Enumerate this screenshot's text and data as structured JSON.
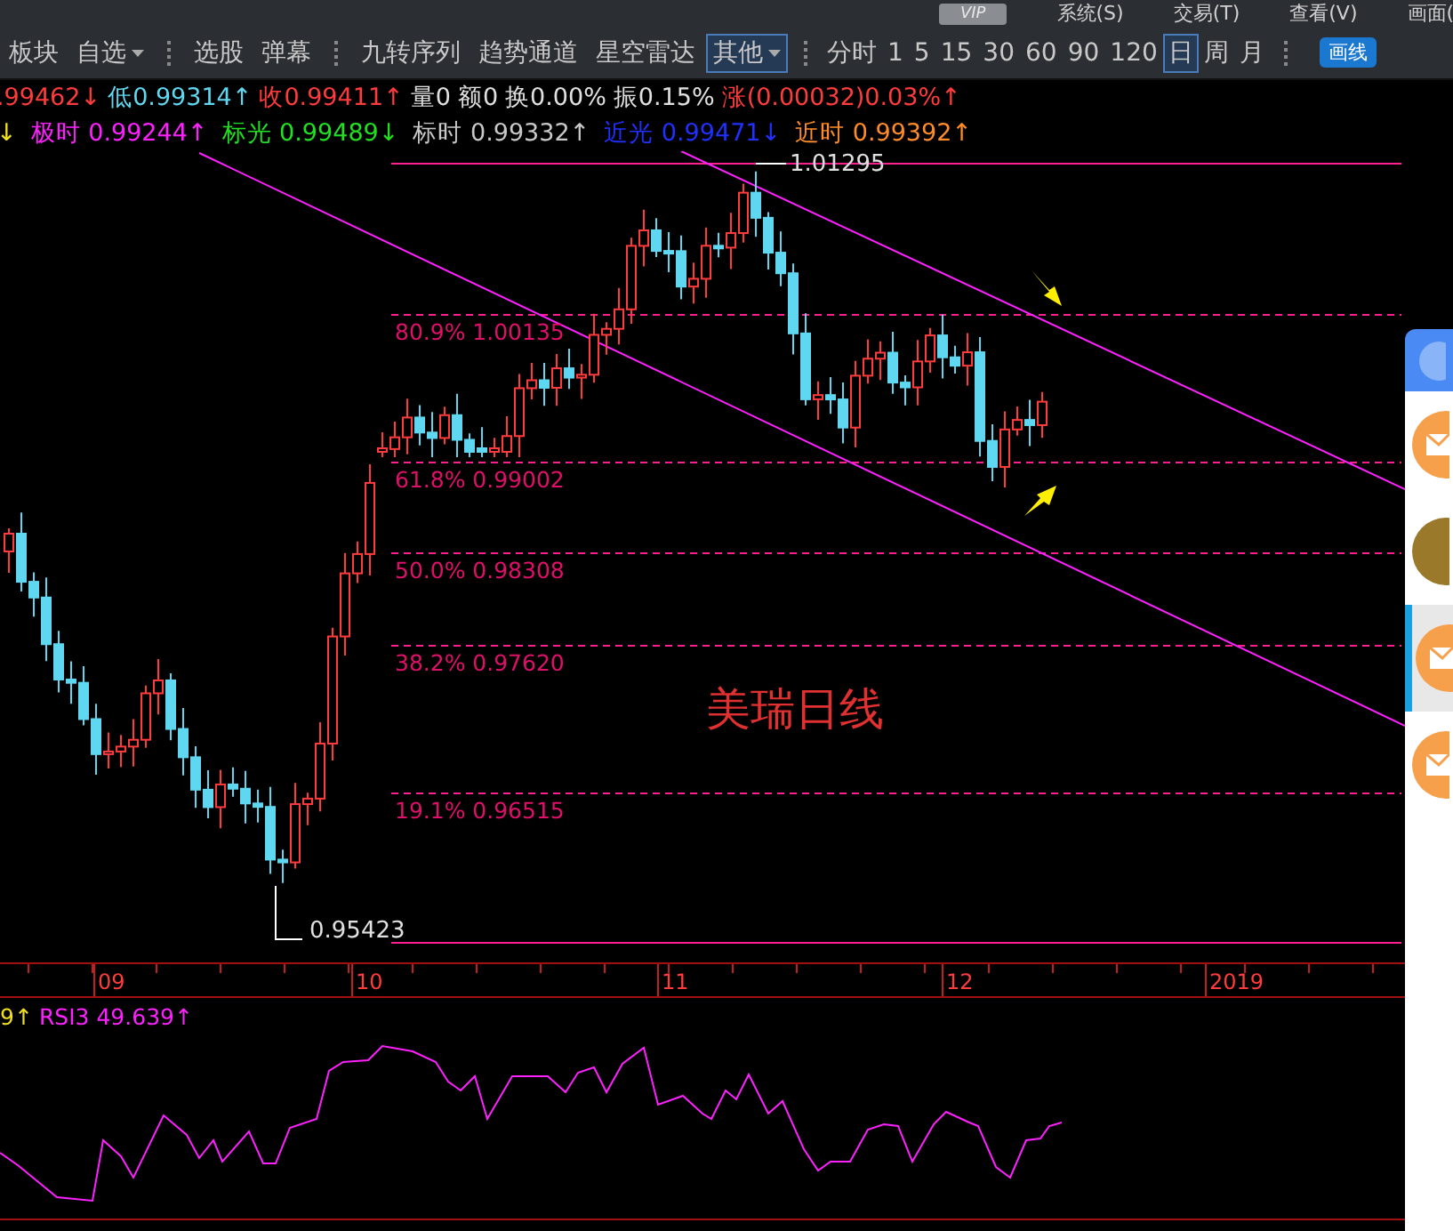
{
  "menu_bar": {
    "badge": "VIP",
    "items": [
      "系统(S)",
      "交易(T)",
      "查看(V)",
      "画面("
    ]
  },
  "toolbar": {
    "groups": [
      [
        {
          "label": "板块",
          "dropdown": false,
          "selected": false
        },
        {
          "label": "自选",
          "dropdown": true,
          "selected": false
        }
      ],
      [
        {
          "label": "选股",
          "dropdown": false,
          "selected": false
        },
        {
          "label": "弹幕",
          "dropdown": false,
          "selected": false
        }
      ],
      [
        {
          "label": "九转序列",
          "dropdown": false,
          "selected": false
        },
        {
          "label": "趋势通道",
          "dropdown": false,
          "selected": false
        },
        {
          "label": "星空雷达",
          "dropdown": false,
          "selected": false
        },
        {
          "label": "其他",
          "dropdown": true,
          "selected": true
        }
      ],
      [
        {
          "label": "分时",
          "dropdown": false,
          "selected": false
        },
        {
          "label": "1",
          "dropdown": false,
          "selected": false
        },
        {
          "label": "5",
          "dropdown": false,
          "selected": false
        },
        {
          "label": "15",
          "dropdown": false,
          "selected": false
        },
        {
          "label": "30",
          "dropdown": false,
          "selected": false
        },
        {
          "label": "60",
          "dropdown": false,
          "selected": false
        },
        {
          "label": "90",
          "dropdown": false,
          "selected": false
        },
        {
          "label": "120",
          "dropdown": false,
          "selected": false
        },
        {
          "label": "日",
          "dropdown": false,
          "selected": true
        },
        {
          "label": "周",
          "dropdown": false,
          "selected": false
        },
        {
          "label": "月",
          "dropdown": false,
          "selected": false
        }
      ]
    ],
    "draw_button": "画线"
  },
  "quote_row": [
    {
      "text": ".99462↓",
      "color": "#ff3b3b"
    },
    {
      "text": "低0.99314↑",
      "color": "#5fd7f0"
    },
    {
      "text": "收0.99411↑",
      "color": "#ff3b3b"
    },
    {
      "text": "量0",
      "color": "#e0e0e0"
    },
    {
      "text": "额0",
      "color": "#e0e0e0"
    },
    {
      "text": "换0.00%",
      "color": "#e0e0e0"
    },
    {
      "text": "振0.15%",
      "color": "#e0e0e0"
    },
    {
      "text": "涨(0.00032)0.03%↑",
      "color": "#ff3b3b"
    }
  ],
  "indicator_row": [
    {
      "text": "↓",
      "color": "#f0e020"
    },
    {
      "text": "极时 0.99244↑",
      "color": "#ff20ff"
    },
    {
      "text": "标光 0.99489↓",
      "color": "#20e020"
    },
    {
      "text": "标时 0.99332↑",
      "color": "#c8c8c8"
    },
    {
      "text": "近光 0.99471↓",
      "color": "#2030ff"
    },
    {
      "text": "近时 0.99392↑",
      "color": "#ff8c28"
    }
  ],
  "price_chart": {
    "high_label": "1.01295",
    "low_label": "0.95423",
    "fib_levels": [
      "80.9% 1.00135",
      "61.8% 0.99002",
      "50.0% 0.98308",
      "38.2% 0.97620",
      "19.1% 0.96515"
    ],
    "title": "美瑞日线",
    "date_axis": [
      "09",
      "10",
      "11",
      "12",
      "2019"
    ]
  },
  "rsi_panel": {
    "labels": [
      {
        "text": "9↑",
        "color": "#f0e020"
      },
      {
        "text": "RSI3 49.639↑",
        "color": "#ff20ff"
      }
    ]
  },
  "side_panel": {
    "items": [
      {
        "kind": "header",
        "selected": false
      },
      {
        "kind": "message",
        "selected": false
      },
      {
        "kind": "photo",
        "selected": false
      },
      {
        "kind": "message",
        "selected": true
      },
      {
        "kind": "message",
        "selected": false
      }
    ]
  }
}
